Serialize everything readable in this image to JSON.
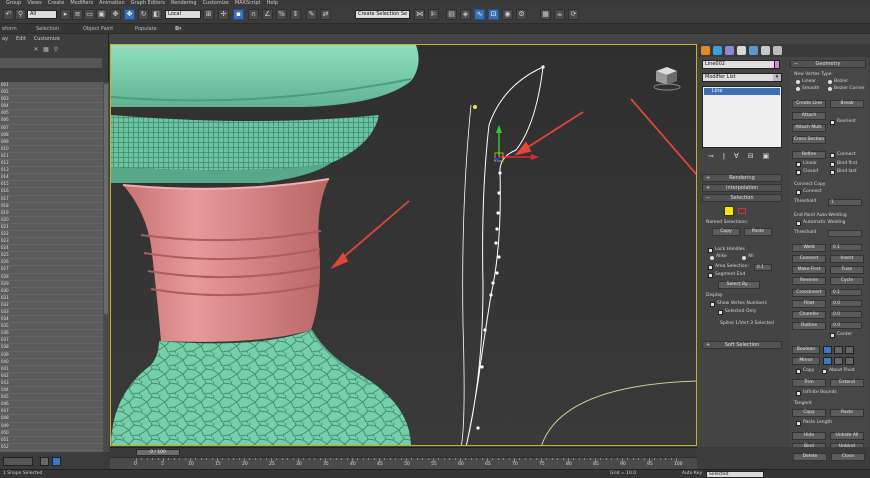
{
  "menubar": {
    "items": [
      "Group",
      "Views",
      "Create",
      "Modifiers",
      "Animation",
      "Graph Editors",
      "Rendering",
      "Customize",
      "MAXScript",
      "Help"
    ]
  },
  "toolbar": {
    "filter_dropdown": "All",
    "coord_dropdown": "Local",
    "selection_set_dropdown": "Create Selection Se"
  },
  "ribbon": {
    "tabs": [
      "eform",
      "Selection",
      "Object Paint",
      "Populate"
    ]
  },
  "scene_explorer": {
    "menu": [
      "ay",
      "Edit",
      "Customize"
    ],
    "rows": [
      "001",
      "002",
      "003",
      "004",
      "005",
      "006",
      "007",
      "008",
      "009",
      "010",
      "011",
      "012",
      "013",
      "014",
      "015",
      "016",
      "017",
      "018",
      "019",
      "020",
      "021",
      "022",
      "023",
      "024",
      "025",
      "026",
      "027",
      "028",
      "029",
      "030",
      "031",
      "032",
      "033",
      "034",
      "035",
      "036",
      "037",
      "038",
      "039",
      "040",
      "041",
      "042",
      "043",
      "044",
      "045",
      "046",
      "047",
      "048",
      "049",
      "050",
      "051",
      "052"
    ]
  },
  "viewport": {
    "label": "[+] [Perspective] [Shaded]",
    "colors": {
      "border": "#c8b020",
      "teal": "#7fd3b0",
      "pink": "#d98686",
      "spline": "#ffffff",
      "arrows": "#e0463a"
    }
  },
  "command_panel": {
    "object_name": "Line002",
    "object_color": "#e37fd5",
    "modifier_list": "Modifier List",
    "stack_item": "Line",
    "rollouts": {
      "rendering": "Rendering",
      "interpolation": "Interpolation",
      "selection": "Selection",
      "soft_selection": "Soft Selection"
    },
    "selection": {
      "named_selections": "Named Selections:",
      "copy": "Copy",
      "paste": "Paste",
      "lock_handles": "Lock Handles",
      "alike": "Alike",
      "all": "All",
      "area_selection": "Area Selection:",
      "area_value": "0.1",
      "segment_end": "Segment End",
      "select_by": "Select By...",
      "display": "Display",
      "show_vertex_numbers": "Show Vertex Numbers",
      "selected_only": "Selected Only",
      "status": "Spline 1/Vert 3 Selected"
    },
    "geometry": {
      "title": "Geometry",
      "new_vertex_type": "New Vertex Type",
      "linear": "Linear",
      "bezier": "Bezier",
      "smooth": "Smooth",
      "bezier_corner": "Bezier Corner",
      "create_line": "Create Line",
      "break": "Break",
      "attach": "Attach",
      "reorient": "Reorient",
      "attach_mult": "Attach Mult.",
      "cross_section": "Cross Section",
      "refine": "Refine",
      "connect": "Connect",
      "linear2": "Linear",
      "bind_first": "Bind first",
      "closed": "Closed",
      "bind_last": "Bind last",
      "connect_copy": "Connect Copy",
      "connect2": "Connect",
      "threshold": "Threshold",
      "threshold_val": "1",
      "end_point_auto_welding": "End Point Auto-Welding",
      "automatic_welding": "Automatic Welding",
      "threshold2": "Threshold",
      "weld": "Weld",
      "weld_val": "0.1",
      "connect3": "Connect",
      "insert": "Insert",
      "make_first": "Make First",
      "fuse": "Fuse",
      "reverse": "Reverse",
      "cycle": "Cycle",
      "crossinsert": "CrossInsert",
      "crossinsert_val": "0.1",
      "fillet": "Fillet",
      "fillet_val": "0.0",
      "chamfer": "Chamfer",
      "chamfer_val": "0.0",
      "outline": "Outline",
      "outline_val": "0.0",
      "center": "Center",
      "boolean": "Boolean",
      "mirror": "Mirror",
      "copy": "Copy",
      "about_pivot": "About Pivot",
      "trim": "Trim",
      "extend": "Extend",
      "infinite_bounds": "Infinite Bounds",
      "tangent": "Tangent",
      "copy2": "Copy",
      "paste": "Paste",
      "paste_length": "Paste Length",
      "hide": "Hide",
      "unhide_all": "Unhide All",
      "bind": "Bind",
      "unbind": "Unbind",
      "delete": "Delete",
      "close": "Close"
    }
  },
  "timeline": {
    "slider": "0 / 100",
    "ticks": [
      "0",
      "5",
      "10",
      "15",
      "20",
      "25",
      "30",
      "35",
      "40",
      "45",
      "50",
      "55",
      "60",
      "65",
      "70",
      "75",
      "80",
      "85",
      "90",
      "95",
      "100"
    ]
  },
  "status": {
    "left": "1 Shape Selected",
    "auto_key": "Auto Key",
    "selected": "Selected",
    "grid": "Grid = 10.0"
  }
}
